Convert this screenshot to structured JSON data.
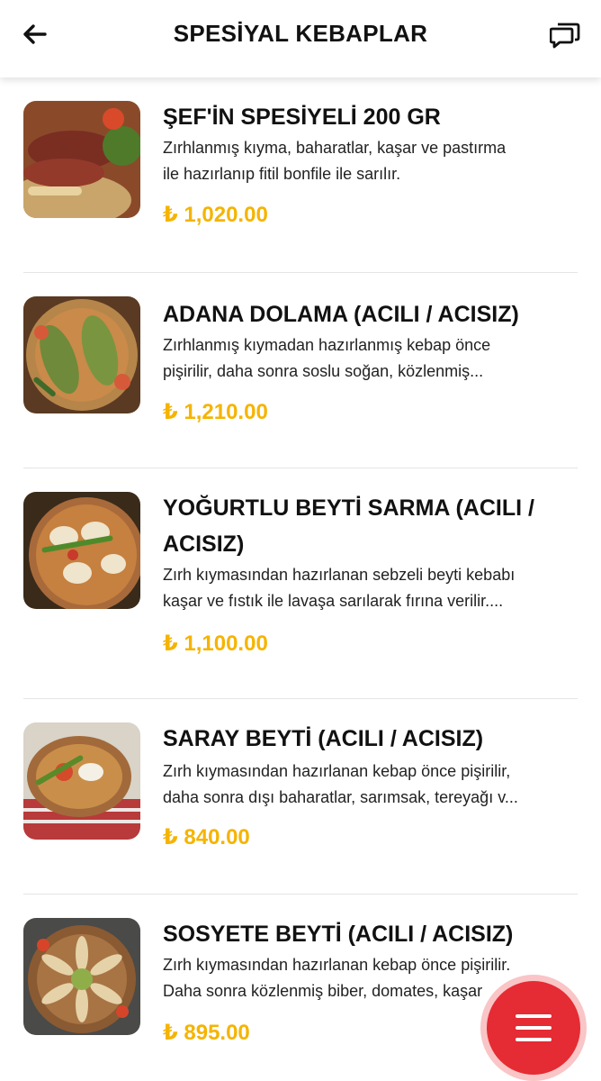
{
  "header": {
    "title": "SPESİYAL KEBAPLAR",
    "back_icon": "arrow-left-icon",
    "chat_icon": "chat-bubbles-icon"
  },
  "items": [
    {
      "name": "ŞEF'İN SPESİYELİ 200 GR",
      "desc_line1": "Zırhlanmış kıyma, baharatlar, kaşar ve pastırma",
      "desc_line2": "ile hazırlanıp fitil bonfile ile sarılır.",
      "price": "₺ 1,020.00"
    },
    {
      "name": "ADANA DOLAMA (ACILI / ACISIZ)",
      "desc_line1": "Zırhlanmış kıymadan hazırlanmış kebap önce",
      "desc_line2": "pişirilir, daha sonra soslu soğan, közlenmiş...",
      "price": "₺ 1,210.00"
    },
    {
      "name": "YOĞURTLU BEYTİ SARMA (ACILI / ACISIZ)",
      "name_line1": "YOĞURTLU BEYTİ SARMA (ACILI /",
      "name_line2": "ACISIZ)",
      "desc_line1": "Zırh kıymasından hazırlanan sebzeli beyti kebabı",
      "desc_line2": "kaşar ve fıstık ile lavaşa sarılarak fırına verilir....",
      "price": "₺ 1,100.00"
    },
    {
      "name": "SARAY BEYTİ (ACILI / ACISIZ)",
      "desc_line1": "Zırh kıymasından hazırlanan kebap önce pişirilir,",
      "desc_line2": "daha sonra dışı baharatlar, sarımsak, tereyağı v...",
      "price": "₺ 840.00"
    },
    {
      "name": "SOSYETE BEYTİ (ACILI / ACISIZ)",
      "desc_line1": "Zırh kıymasından hazırlanan kebap önce pişirilir.",
      "desc_line2": "Daha sonra közlenmiş biber, domates, kaşar",
      "price": "₺ 895.00"
    }
  ],
  "fab": {
    "icon": "menu-icon"
  },
  "colors": {
    "price": "#f5b400",
    "fab": "#e52b33"
  }
}
